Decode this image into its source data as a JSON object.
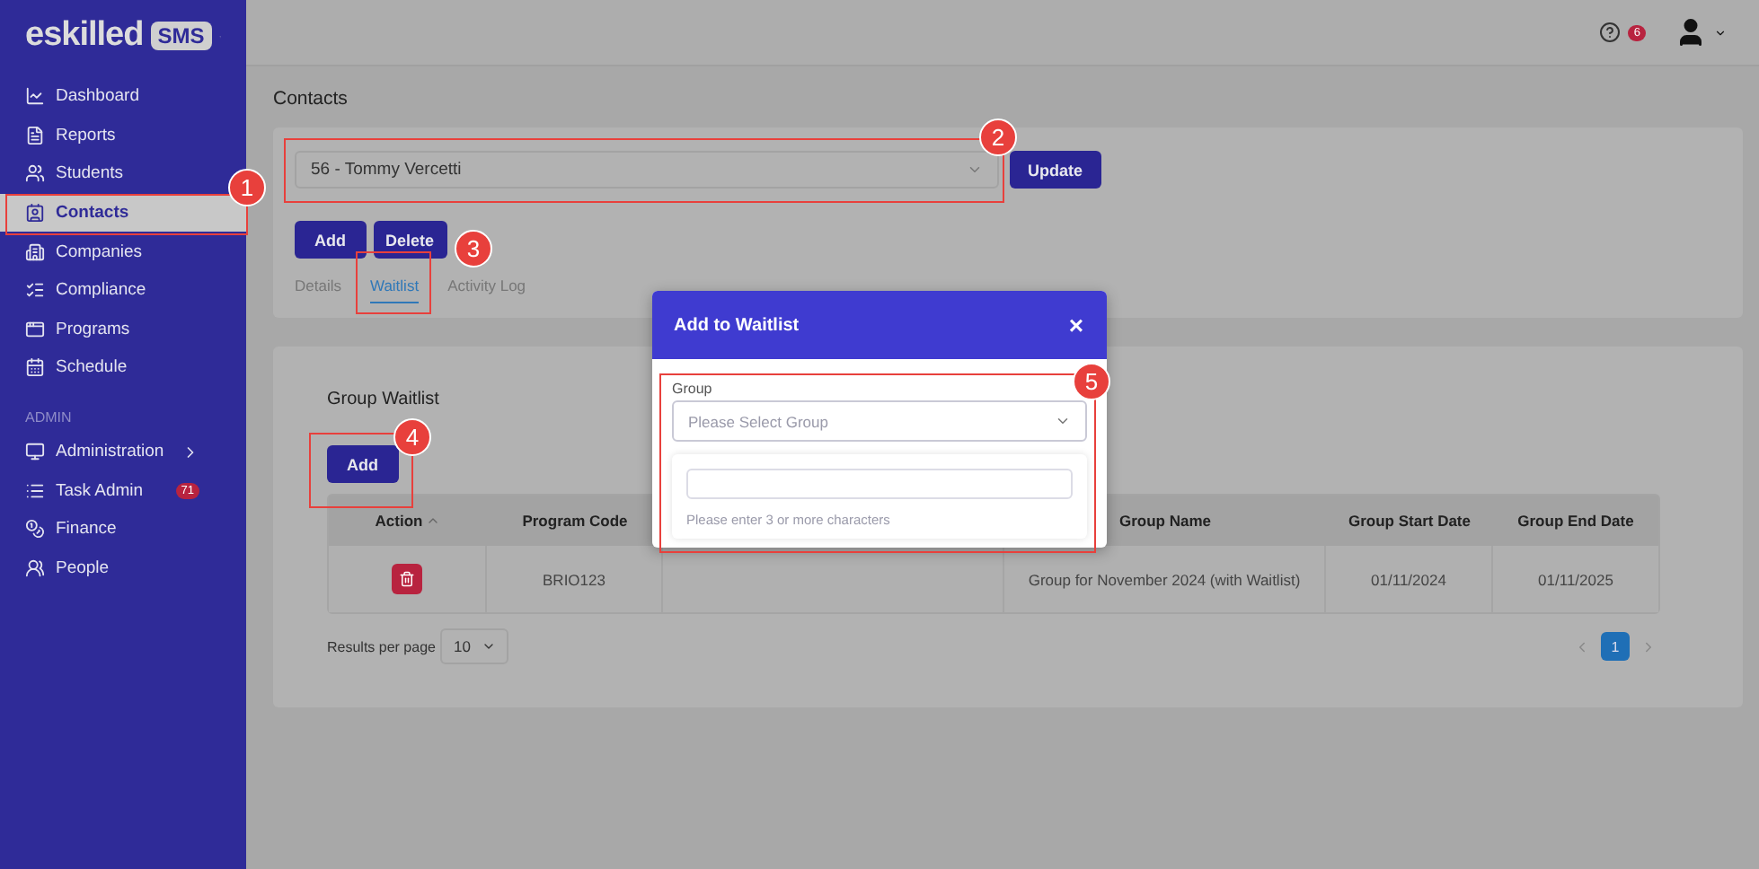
{
  "sidebar": {
    "brand": "eskilled",
    "brand_badge": "SMS",
    "items": [
      {
        "label": "Dashboard",
        "selected": false
      },
      {
        "label": "Reports",
        "selected": false
      },
      {
        "label": "Students",
        "selected": false
      },
      {
        "label": "Contacts",
        "selected": true
      },
      {
        "label": "Companies",
        "selected": false
      },
      {
        "label": "Compliance",
        "selected": false
      },
      {
        "label": "Programs",
        "selected": false
      },
      {
        "label": "Schedule",
        "selected": false
      }
    ],
    "section": "ADMIN",
    "admin_items": [
      {
        "label": "Administration",
        "selected": false,
        "kind": "expandable"
      },
      {
        "label": "Task Admin",
        "selected": false,
        "kind": "badge",
        "badge": "71"
      },
      {
        "label": "Finance",
        "selected": false,
        "kind": "plain"
      },
      {
        "label": "People",
        "selected": false,
        "kind": "plain"
      }
    ]
  },
  "topbar": {
    "notification_count": "6"
  },
  "page_title": "Contacts",
  "contact_select": {
    "value": "56 - Tommy Vercetti"
  },
  "update_button": "Update",
  "action_buttons": [
    "Add",
    "Delete"
  ],
  "tabs": [
    {
      "label": "Details",
      "selected": false
    },
    {
      "label": "Waitlist",
      "selected": true
    },
    {
      "label": "Activity Log",
      "selected": false
    }
  ],
  "waitlist": {
    "title": "Group Waitlist",
    "add_button": "Add",
    "columns": [
      "Action",
      "Program Code",
      null,
      "Group Name",
      "Group Start Date",
      "Group End Date"
    ],
    "rows": [
      {
        "program_code": "BRIO123",
        "group_name": "Group for November 2024 (with Waitlist)",
        "start": "01/11/2024",
        "end": "01/11/2025"
      }
    ],
    "results_label": "Results per page",
    "page_size": "10",
    "pages": [
      {
        "label": "1",
        "selected": true
      }
    ]
  },
  "modal": {
    "title": "Add to Waitlist",
    "close": "×",
    "field_label": "Group",
    "placeholder": "Please Select Group",
    "hint": "Please enter 3 or more characters"
  },
  "callouts": [
    "1",
    "2",
    "3",
    "4",
    "5"
  ]
}
